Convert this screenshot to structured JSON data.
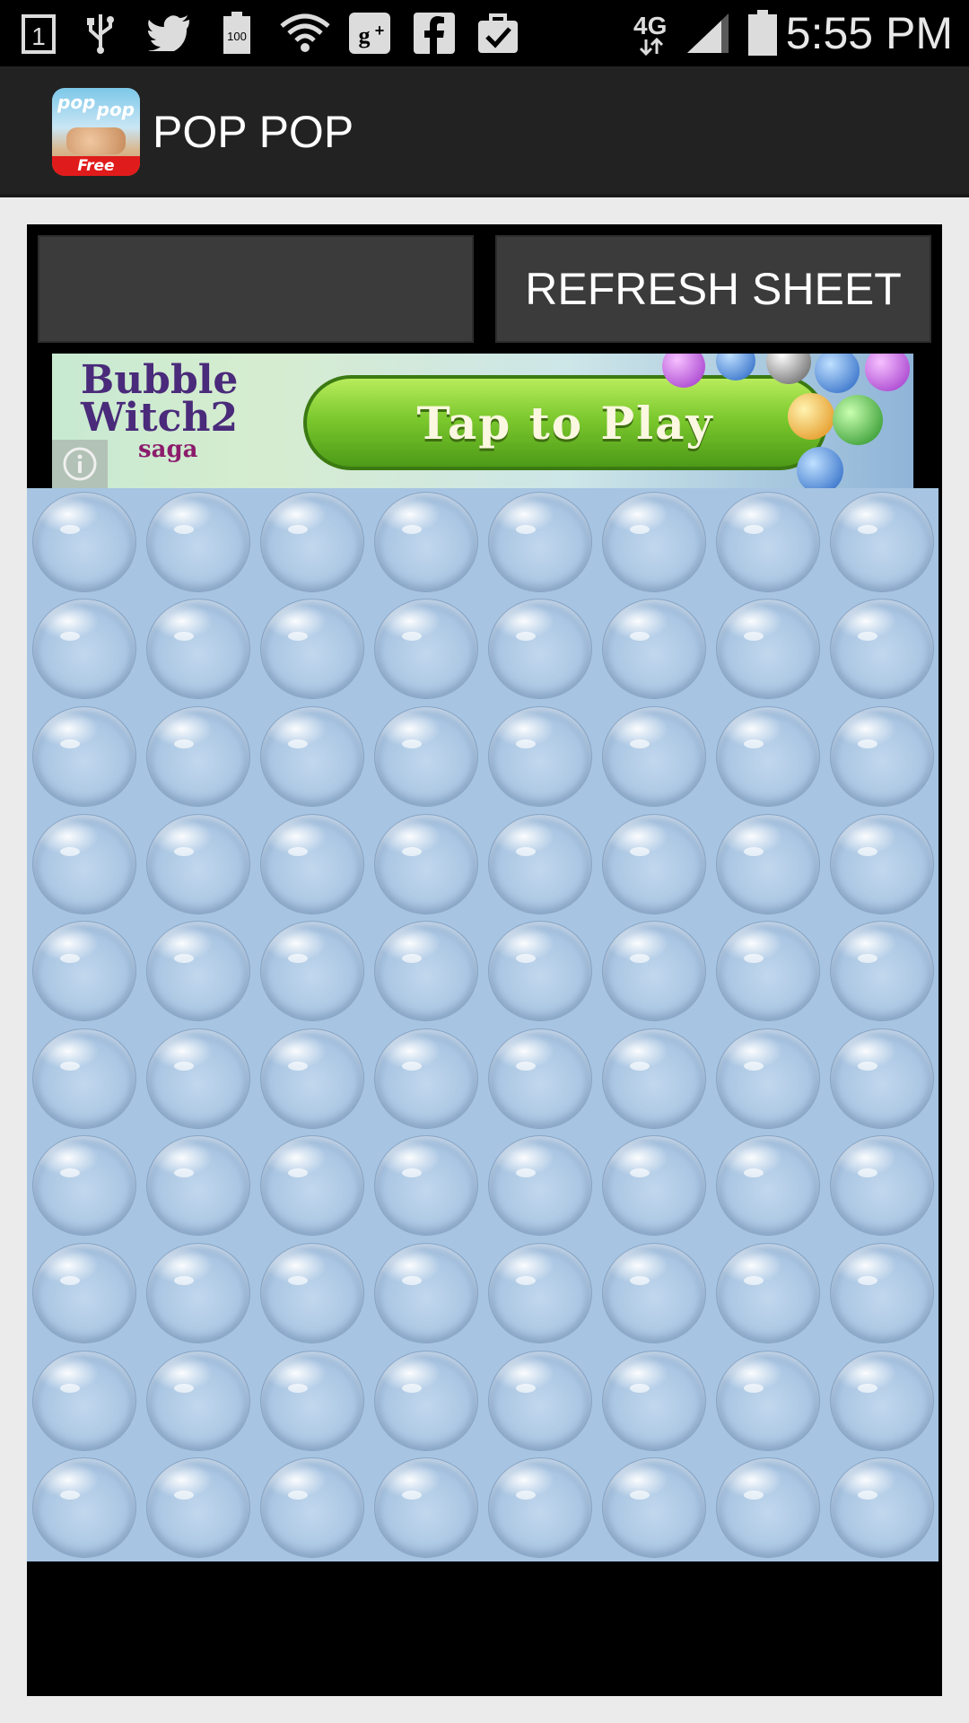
{
  "status_bar": {
    "time": "5:55 PM",
    "icons": [
      "notification-one-icon",
      "usb-icon",
      "twitter-icon",
      "battery-100-icon",
      "wifi-icon",
      "google-plus-icon",
      "facebook-icon",
      "clipboard-check-icon",
      "4g-lte-icon",
      "signal-icon",
      "battery-icon"
    ],
    "notif_count": "1",
    "battery_label": "100",
    "network_label": "4G"
  },
  "action_bar": {
    "title": "POP POP",
    "app_icon_text_1": "pop",
    "app_icon_text_2": "pop",
    "app_icon_badge": "Free"
  },
  "controls": {
    "left_button_label": "",
    "right_button_label": "REFRESH SHEET"
  },
  "ad": {
    "brand_line_1": "Bubble",
    "brand_line_2": "Witch2",
    "brand_line_3": "saga",
    "cta": "Tap to Play",
    "info_icon": "info-icon"
  },
  "sheet": {
    "columns": 8,
    "rows": 10,
    "bubble_color": "#a7c5e2"
  },
  "colors": {
    "status_bar_bg": "#000000",
    "action_bar_bg": "#222222",
    "button_bg": "#3b3b3b",
    "sheet_bg": "#a7c5e2",
    "cta_green": "#7cc92e"
  }
}
